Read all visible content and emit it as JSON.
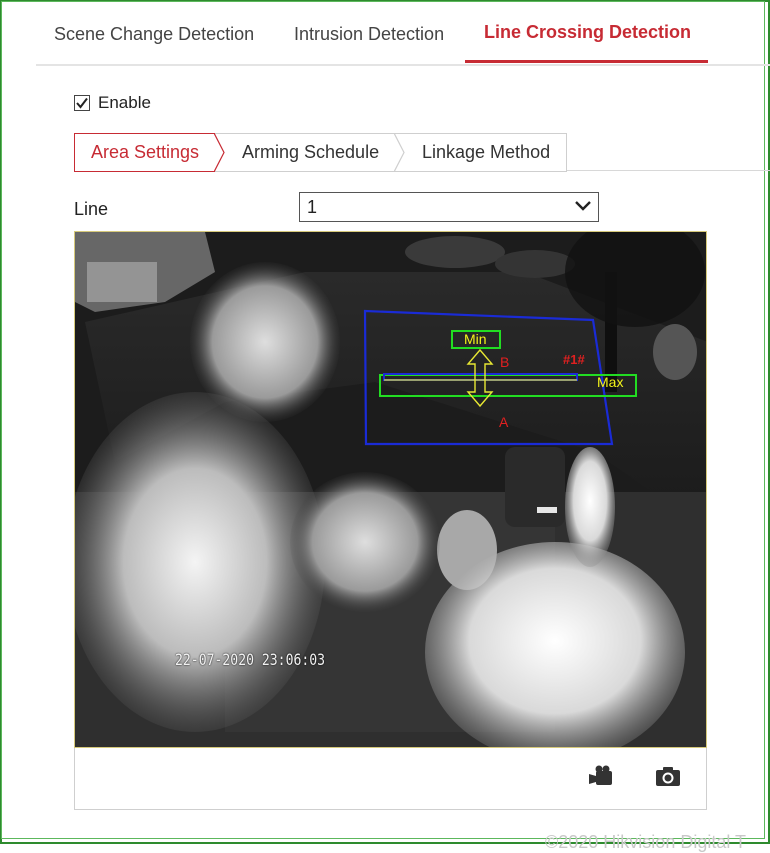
{
  "tabs": [
    {
      "label": "Scene Change Detection",
      "active": false
    },
    {
      "label": "Intrusion Detection",
      "active": false
    },
    {
      "label": "Line Crossing Detection",
      "active": true
    }
  ],
  "enable": {
    "label": "Enable",
    "checked": true
  },
  "subtabs": [
    {
      "label": "Area Settings",
      "active": true
    },
    {
      "label": "Arming Schedule",
      "active": false
    },
    {
      "label": "Linkage Method",
      "active": false
    }
  ],
  "line": {
    "label": "Line",
    "selected": "1"
  },
  "video": {
    "timestamp": "22-07-2020 23:06:03",
    "overlay": {
      "min_label": "Min",
      "max_label": "Max",
      "line_id": "#1#",
      "side_a": "A",
      "side_b": "B"
    }
  },
  "toolbar": {
    "record_icon": "video-record-icon",
    "capture_icon": "camera-icon"
  },
  "footer": {
    "copyright": "©2020 Hikvision Digital T"
  },
  "colors": {
    "accent": "#c72b34",
    "region": "#1a2bd6",
    "minmax": "#22dd22",
    "arrow": "#e8e833",
    "label_red": "#e02020"
  }
}
